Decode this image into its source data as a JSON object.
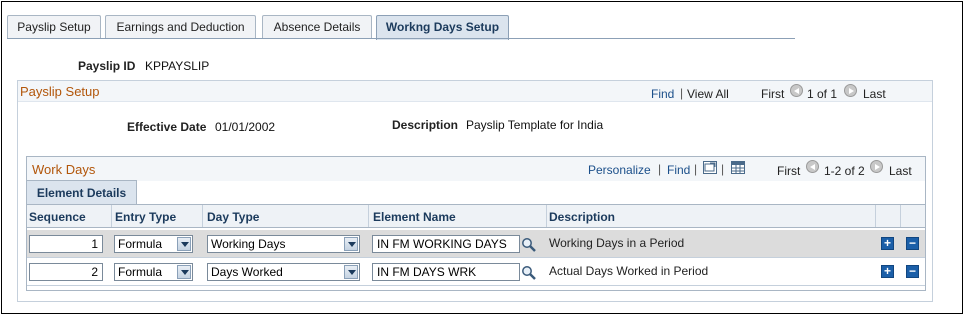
{
  "tabs": [
    {
      "label": "Payslip Setup",
      "active": false
    },
    {
      "label": "Earnings and Deduction",
      "active": false
    },
    {
      "label": "Absence Details",
      "active": false
    },
    {
      "label": "Workng Days Setup",
      "active": true
    }
  ],
  "payslip": {
    "id_label": "Payslip ID",
    "id_value": "KPPAYSLIP"
  },
  "setup": {
    "title": "Payslip Setup",
    "find": "Find",
    "view_all": "View All",
    "first": "First",
    "range": "1 of 1",
    "last": "Last",
    "effective_date_label": "Effective Date",
    "effective_date": "01/01/2002",
    "description_label": "Description",
    "description": "Payslip Template for India"
  },
  "workdays": {
    "title": "Work Days",
    "personalize": "Personalize",
    "find": "Find",
    "first": "First",
    "range": "1-2 of 2",
    "last": "Last",
    "subtab": "Element Details",
    "columns": {
      "sequence": "Sequence",
      "entry_type": "Entry Type",
      "day_type": "Day Type",
      "element_name": "Element Name",
      "description": "Description"
    },
    "rows": [
      {
        "sequence": "1",
        "entry_type": "Formula",
        "day_type": "Working Days",
        "element_name": "IN FM WORKING DAYS",
        "description": "Working Days in a Period"
      },
      {
        "sequence": "2",
        "entry_type": "Formula",
        "day_type": "Days Worked",
        "element_name": "IN FM DAYS WRK",
        "description": "Actual Days Worked in Period"
      }
    ]
  },
  "colors": {
    "accent_link": "#1b4f8a",
    "section_title": "#b2560a",
    "header_bg": "#dbe4ee"
  }
}
